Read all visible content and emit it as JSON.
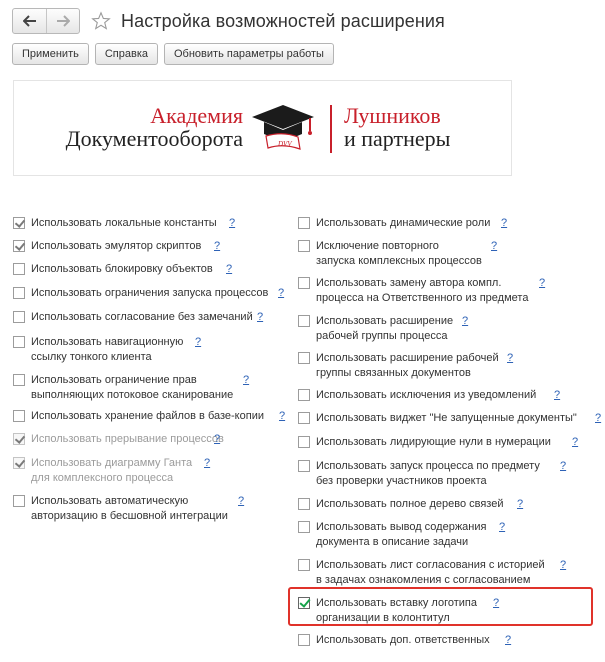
{
  "window": {
    "title": "Настройка возможностей расширения"
  },
  "toolbar": {
    "apply_label": "Применить",
    "help_label": "Справка",
    "update_label": "Обновить параметры работы"
  },
  "banner": {
    "left_line1": "Академия",
    "left_line2": "Документооборота",
    "right_line1": "Лушников",
    "right_line2": "и партнеры",
    "cap_text": "DVV"
  },
  "help_mark": "?",
  "left_options": [
    {
      "label": "Использовать локальные константы",
      "checked": true,
      "disabled": false
    },
    {
      "label": "Использовать эмулятор скриптов",
      "checked": true,
      "disabled": false
    },
    {
      "label": "Использовать блокировку объектов",
      "checked": false,
      "disabled": false
    },
    {
      "label": "Использовать ограничения запуска процессов",
      "checked": false,
      "disabled": false
    },
    {
      "label": "Использовать согласование без замечаний",
      "checked": false,
      "disabled": false
    },
    {
      "label": "Использовать навигационную\nссылку тонкого клиента",
      "checked": false,
      "disabled": false
    },
    {
      "label": "Использовать ограничение прав\nвыполняющих потоковое сканирование",
      "checked": false,
      "disabled": false
    },
    {
      "label": "Использовать хранение файлов в базе-копии",
      "checked": false,
      "disabled": false
    },
    {
      "label": "Использовать прерывание процессов",
      "checked": true,
      "disabled": true
    },
    {
      "label": "Использовать диаграмму Ганта\nдля комплексного процесса",
      "checked": true,
      "disabled": true
    },
    {
      "label": "Использовать автоматическую\nавторизацию в бесшовной интеграции",
      "checked": false,
      "disabled": false
    }
  ],
  "right_options": [
    {
      "label": "Использовать динамические роли",
      "checked": false
    },
    {
      "label": "Исключение повторного\nзапуска комплексных процессов",
      "checked": false
    },
    {
      "label": "Использовать замену автора компл.\nпроцесса на Ответственного из предмета",
      "checked": false
    },
    {
      "label": "Использовать расширение\nрабочей группы процесса",
      "checked": false
    },
    {
      "label": "Использовать расширение рабочей\nгруппы связанных документов",
      "checked": false
    },
    {
      "label": "Использовать исключения из уведомлений",
      "checked": false
    },
    {
      "label": "Использовать виджет \"Не запущенные документы\"",
      "checked": false
    },
    {
      "label": "Использовать лидирующие нули в нумерации",
      "checked": false
    },
    {
      "label": "Использовать запуск процесса по предмету\nбез проверки участников проекта",
      "checked": false
    },
    {
      "label": "Использовать полное дерево связей",
      "checked": false
    },
    {
      "label": "Использовать вывод содержания\nдокумента в описание задачи",
      "checked": false
    },
    {
      "label": "Использовать лист согласования с историей\nв задачах ознакомления с согласованием",
      "checked": false
    },
    {
      "label": "Использовать вставку логотипа\nорганизации в колонтитул",
      "checked": true
    },
    {
      "label": "Использовать доп. ответственных",
      "checked": false
    }
  ]
}
